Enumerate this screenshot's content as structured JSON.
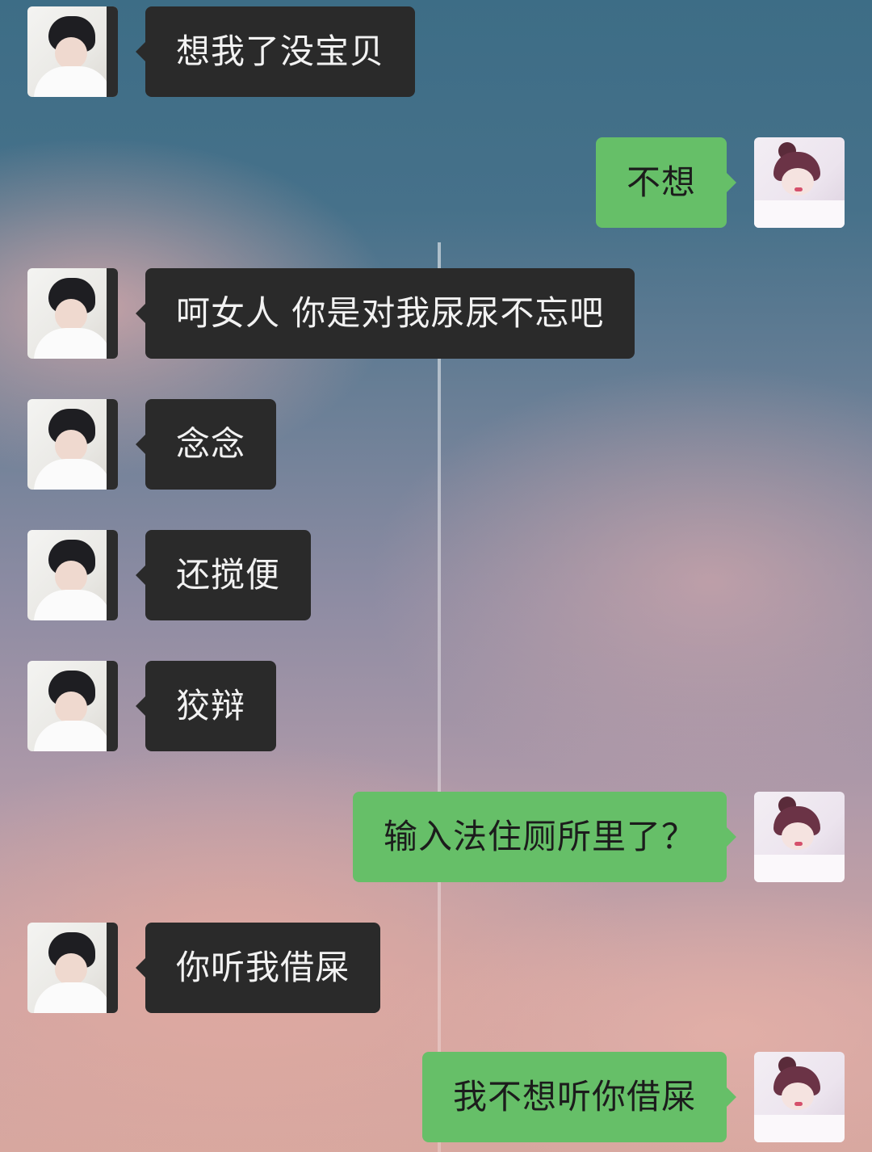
{
  "messages": [
    {
      "side": "left",
      "sender": "boy",
      "text": "想我了没宝贝"
    },
    {
      "side": "right",
      "sender": "girl",
      "text": "不想"
    },
    {
      "side": "left",
      "sender": "boy",
      "text": "呵女人 你是对我尿尿不忘吧"
    },
    {
      "side": "left",
      "sender": "boy",
      "text": "念念"
    },
    {
      "side": "left",
      "sender": "boy",
      "text": "还搅便"
    },
    {
      "side": "left",
      "sender": "boy",
      "text": "狡辩"
    },
    {
      "side": "right",
      "sender": "girl",
      "text": "输入法住厕所里了？"
    },
    {
      "side": "left",
      "sender": "boy",
      "text": "你听我借屎"
    },
    {
      "side": "right",
      "sender": "girl",
      "text": "我不想听你借屎"
    }
  ],
  "colors": {
    "incoming_bubble": "#2a2a2a",
    "outgoing_bubble": "#66bf68",
    "incoming_text": "#f2f2f2",
    "outgoing_text": "#1c1c1c"
  }
}
